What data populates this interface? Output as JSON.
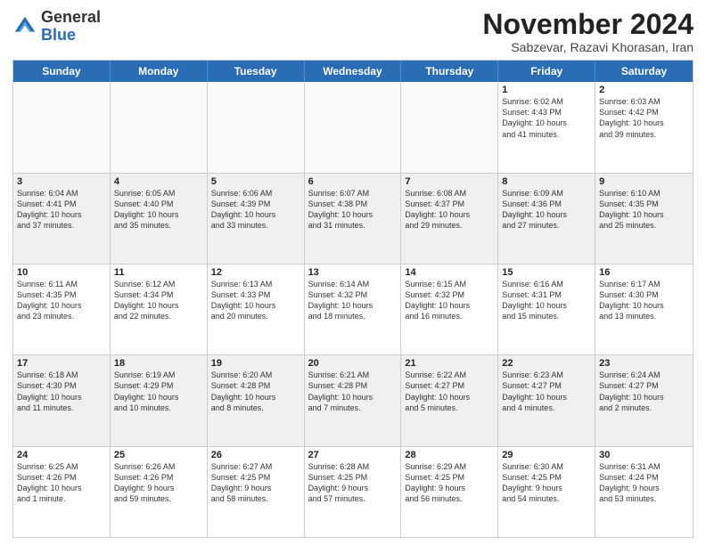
{
  "header": {
    "logo_general": "General",
    "logo_blue": "Blue",
    "month_title": "November 2024",
    "subtitle": "Sabzevar, Razavi Khorasan, Iran"
  },
  "days_of_week": [
    "Sunday",
    "Monday",
    "Tuesday",
    "Wednesday",
    "Thursday",
    "Friday",
    "Saturday"
  ],
  "weeks": [
    [
      {
        "day": "",
        "info": "",
        "empty": true
      },
      {
        "day": "",
        "info": "",
        "empty": true
      },
      {
        "day": "",
        "info": "",
        "empty": true
      },
      {
        "day": "",
        "info": "",
        "empty": true
      },
      {
        "day": "",
        "info": "",
        "empty": true
      },
      {
        "day": "1",
        "info": "Sunrise: 6:02 AM\nSunset: 4:43 PM\nDaylight: 10 hours\nand 41 minutes."
      },
      {
        "day": "2",
        "info": "Sunrise: 6:03 AM\nSunset: 4:42 PM\nDaylight: 10 hours\nand 39 minutes."
      }
    ],
    [
      {
        "day": "3",
        "info": "Sunrise: 6:04 AM\nSunset: 4:41 PM\nDaylight: 10 hours\nand 37 minutes."
      },
      {
        "day": "4",
        "info": "Sunrise: 6:05 AM\nSunset: 4:40 PM\nDaylight: 10 hours\nand 35 minutes."
      },
      {
        "day": "5",
        "info": "Sunrise: 6:06 AM\nSunset: 4:39 PM\nDaylight: 10 hours\nand 33 minutes."
      },
      {
        "day": "6",
        "info": "Sunrise: 6:07 AM\nSunset: 4:38 PM\nDaylight: 10 hours\nand 31 minutes."
      },
      {
        "day": "7",
        "info": "Sunrise: 6:08 AM\nSunset: 4:37 PM\nDaylight: 10 hours\nand 29 minutes."
      },
      {
        "day": "8",
        "info": "Sunrise: 6:09 AM\nSunset: 4:36 PM\nDaylight: 10 hours\nand 27 minutes."
      },
      {
        "day": "9",
        "info": "Sunrise: 6:10 AM\nSunset: 4:35 PM\nDaylight: 10 hours\nand 25 minutes."
      }
    ],
    [
      {
        "day": "10",
        "info": "Sunrise: 6:11 AM\nSunset: 4:35 PM\nDaylight: 10 hours\nand 23 minutes."
      },
      {
        "day": "11",
        "info": "Sunrise: 6:12 AM\nSunset: 4:34 PM\nDaylight: 10 hours\nand 22 minutes."
      },
      {
        "day": "12",
        "info": "Sunrise: 6:13 AM\nSunset: 4:33 PM\nDaylight: 10 hours\nand 20 minutes."
      },
      {
        "day": "13",
        "info": "Sunrise: 6:14 AM\nSunset: 4:32 PM\nDaylight: 10 hours\nand 18 minutes."
      },
      {
        "day": "14",
        "info": "Sunrise: 6:15 AM\nSunset: 4:32 PM\nDaylight: 10 hours\nand 16 minutes."
      },
      {
        "day": "15",
        "info": "Sunrise: 6:16 AM\nSunset: 4:31 PM\nDaylight: 10 hours\nand 15 minutes."
      },
      {
        "day": "16",
        "info": "Sunrise: 6:17 AM\nSunset: 4:30 PM\nDaylight: 10 hours\nand 13 minutes."
      }
    ],
    [
      {
        "day": "17",
        "info": "Sunrise: 6:18 AM\nSunset: 4:30 PM\nDaylight: 10 hours\nand 11 minutes."
      },
      {
        "day": "18",
        "info": "Sunrise: 6:19 AM\nSunset: 4:29 PM\nDaylight: 10 hours\nand 10 minutes."
      },
      {
        "day": "19",
        "info": "Sunrise: 6:20 AM\nSunset: 4:28 PM\nDaylight: 10 hours\nand 8 minutes."
      },
      {
        "day": "20",
        "info": "Sunrise: 6:21 AM\nSunset: 4:28 PM\nDaylight: 10 hours\nand 7 minutes."
      },
      {
        "day": "21",
        "info": "Sunrise: 6:22 AM\nSunset: 4:27 PM\nDaylight: 10 hours\nand 5 minutes."
      },
      {
        "day": "22",
        "info": "Sunrise: 6:23 AM\nSunset: 4:27 PM\nDaylight: 10 hours\nand 4 minutes."
      },
      {
        "day": "23",
        "info": "Sunrise: 6:24 AM\nSunset: 4:27 PM\nDaylight: 10 hours\nand 2 minutes."
      }
    ],
    [
      {
        "day": "24",
        "info": "Sunrise: 6:25 AM\nSunset: 4:26 PM\nDaylight: 10 hours\nand 1 minute."
      },
      {
        "day": "25",
        "info": "Sunrise: 6:26 AM\nSunset: 4:26 PM\nDaylight: 9 hours\nand 59 minutes."
      },
      {
        "day": "26",
        "info": "Sunrise: 6:27 AM\nSunset: 4:25 PM\nDaylight: 9 hours\nand 58 minutes."
      },
      {
        "day": "27",
        "info": "Sunrise: 6:28 AM\nSunset: 4:25 PM\nDaylight: 9 hours\nand 57 minutes."
      },
      {
        "day": "28",
        "info": "Sunrise: 6:29 AM\nSunset: 4:25 PM\nDaylight: 9 hours\nand 56 minutes."
      },
      {
        "day": "29",
        "info": "Sunrise: 6:30 AM\nSunset: 4:25 PM\nDaylight: 9 hours\nand 54 minutes."
      },
      {
        "day": "30",
        "info": "Sunrise: 6:31 AM\nSunset: 4:24 PM\nDaylight: 9 hours\nand 53 minutes."
      }
    ]
  ]
}
